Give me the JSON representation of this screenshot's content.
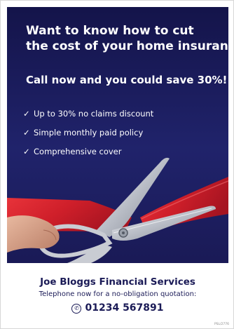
{
  "ad": {
    "headline_lines": [
      "Want to know how to cut",
      "the cost of your home insurance?"
    ],
    "offer": "Call now and you could save 30%!",
    "benefits": [
      "Up to 30% no claims discount",
      "Simple monthly paid policy",
      "Comprehensive cover"
    ],
    "tick_glyph": "✓",
    "image_icon": "scissors-cutting-ribbon",
    "colors": {
      "navy": "#1b1b57",
      "ribbon_red": "#d21f2a",
      "white": "#ffffff"
    }
  },
  "footer": {
    "company": "Joe Bloggs Financial Services",
    "tagline": "Telephone now for a no-obligation quotation:",
    "phone": "01234 567891",
    "phone_icon": "phone-icon",
    "reference": "PSL/2776"
  }
}
